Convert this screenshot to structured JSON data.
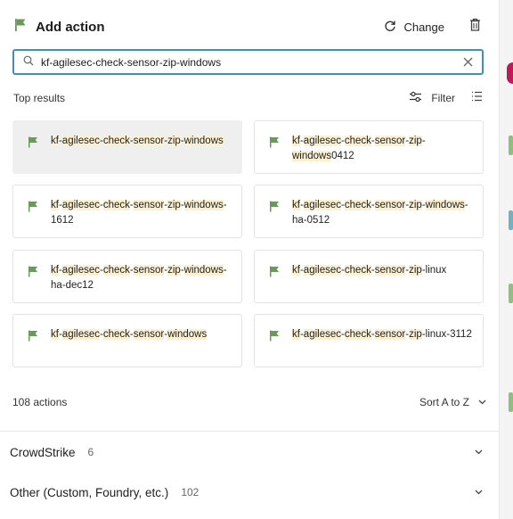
{
  "header": {
    "title": "Add action",
    "change_label": "Change",
    "accent_color": "#6a9a5a"
  },
  "search": {
    "value": "kf-agilesec-check-sensor-zip-windows",
    "focus_color": "#3f8fb8"
  },
  "results": {
    "label": "Top results",
    "filter_label": "Filter",
    "highlight_color": "#fbf0d2",
    "cards": [
      {
        "parts": [
          {
            "t": "kf",
            "h": true
          },
          {
            "t": "-",
            "h": false
          },
          {
            "t": "agilesec",
            "h": true
          },
          {
            "t": "-",
            "h": false
          },
          {
            "t": "check",
            "h": true
          },
          {
            "t": "-",
            "h": false
          },
          {
            "t": "sensor",
            "h": true
          },
          {
            "t": "-",
            "h": false
          },
          {
            "t": "zip",
            "h": true
          },
          {
            "t": "-",
            "h": false
          },
          {
            "t": "windows",
            "h": true
          }
        ],
        "selected": true
      },
      {
        "parts": [
          {
            "t": "kf",
            "h": true
          },
          {
            "t": "-",
            "h": false
          },
          {
            "t": "agilesec",
            "h": true
          },
          {
            "t": "-",
            "h": false
          },
          {
            "t": "check",
            "h": true
          },
          {
            "t": "-",
            "h": false
          },
          {
            "t": "sensor",
            "h": true
          },
          {
            "t": "-",
            "h": false
          },
          {
            "t": "zip",
            "h": true
          },
          {
            "t": "-",
            "h": false
          },
          {
            "t": "windows",
            "h": true
          },
          {
            "t": "0412",
            "h": false
          }
        ],
        "selected": false
      },
      {
        "parts": [
          {
            "t": "kf",
            "h": true
          },
          {
            "t": "-",
            "h": false
          },
          {
            "t": "agilesec",
            "h": true
          },
          {
            "t": "-",
            "h": false
          },
          {
            "t": "check",
            "h": true
          },
          {
            "t": "-",
            "h": false
          },
          {
            "t": "sensor",
            "h": true
          },
          {
            "t": "-",
            "h": false
          },
          {
            "t": "zip",
            "h": true
          },
          {
            "t": "-",
            "h": false
          },
          {
            "t": "windows",
            "h": true
          },
          {
            "t": "-1612",
            "h": false
          }
        ],
        "selected": false
      },
      {
        "parts": [
          {
            "t": "kf",
            "h": true
          },
          {
            "t": "-",
            "h": false
          },
          {
            "t": "agilesec",
            "h": true
          },
          {
            "t": "-",
            "h": false
          },
          {
            "t": "check",
            "h": true
          },
          {
            "t": "-",
            "h": false
          },
          {
            "t": "sensor",
            "h": true
          },
          {
            "t": "-",
            "h": false
          },
          {
            "t": "zip",
            "h": true
          },
          {
            "t": "-",
            "h": false
          },
          {
            "t": "windows",
            "h": true
          },
          {
            "t": "-ha-0512",
            "h": false
          }
        ],
        "selected": false
      },
      {
        "parts": [
          {
            "t": "kf",
            "h": true
          },
          {
            "t": "-",
            "h": false
          },
          {
            "t": "agilesec",
            "h": true
          },
          {
            "t": "-",
            "h": false
          },
          {
            "t": "check",
            "h": true
          },
          {
            "t": "-",
            "h": false
          },
          {
            "t": "sensor",
            "h": true
          },
          {
            "t": "-",
            "h": false
          },
          {
            "t": "zip",
            "h": true
          },
          {
            "t": "-",
            "h": false
          },
          {
            "t": "windows",
            "h": true
          },
          {
            "t": "-ha-dec12",
            "h": false
          }
        ],
        "selected": false
      },
      {
        "parts": [
          {
            "t": "kf",
            "h": true
          },
          {
            "t": "-",
            "h": false
          },
          {
            "t": "agilesec",
            "h": true
          },
          {
            "t": "-",
            "h": false
          },
          {
            "t": "check",
            "h": true
          },
          {
            "t": "-",
            "h": false
          },
          {
            "t": "sensor",
            "h": true
          },
          {
            "t": "-",
            "h": false
          },
          {
            "t": "zip",
            "h": true
          },
          {
            "t": "-linux",
            "h": false
          }
        ],
        "selected": false
      },
      {
        "parts": [
          {
            "t": "kf",
            "h": true
          },
          {
            "t": "-",
            "h": false
          },
          {
            "t": "agilesec",
            "h": true
          },
          {
            "t": "-",
            "h": false
          },
          {
            "t": "check",
            "h": true
          },
          {
            "t": "-",
            "h": false
          },
          {
            "t": "sensor",
            "h": true
          },
          {
            "t": "-",
            "h": false
          },
          {
            "t": "windows",
            "h": true
          }
        ],
        "selected": false
      },
      {
        "parts": [
          {
            "t": "kf",
            "h": true
          },
          {
            "t": "-",
            "h": false
          },
          {
            "t": "agilesec",
            "h": true
          },
          {
            "t": "-",
            "h": false
          },
          {
            "t": "check",
            "h": true
          },
          {
            "t": "-",
            "h": false
          },
          {
            "t": "sensor",
            "h": true
          },
          {
            "t": "-",
            "h": false
          },
          {
            "t": "zip",
            "h": true
          },
          {
            "t": "-linux-3112",
            "h": false
          }
        ],
        "selected": false
      }
    ]
  },
  "footer": {
    "count_label": "108 actions",
    "sort_label": "Sort A to Z"
  },
  "groups": [
    {
      "name": "CrowdStrike",
      "count": "6"
    },
    {
      "name": "Other (Custom, Foundry, etc.)",
      "count": "102"
    }
  ]
}
